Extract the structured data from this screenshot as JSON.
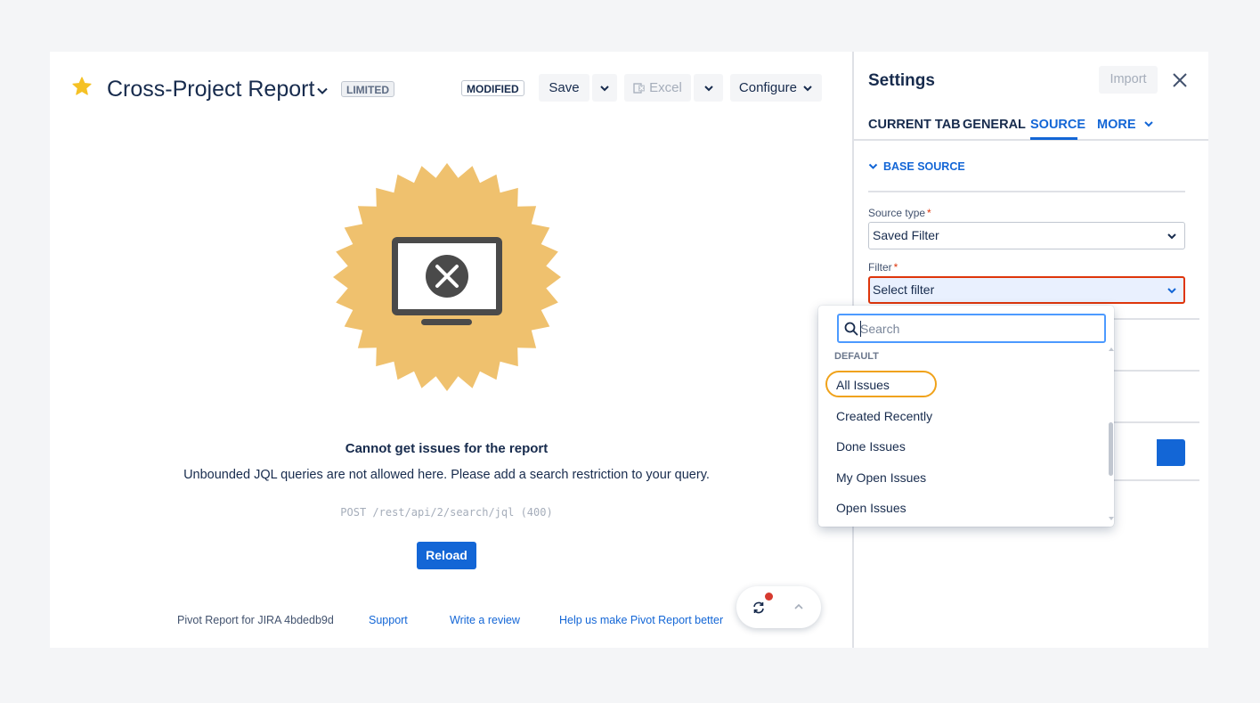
{
  "report": {
    "title": "Cross-Project Report",
    "badge_limited": "LIMITED",
    "badge_modified": "MODIFIED"
  },
  "toolbar": {
    "save_label": "Save",
    "excel_label": "Excel",
    "configure_label": "Configure"
  },
  "error": {
    "title": "Cannot get issues for the report",
    "message": "Unbounded JQL queries are not allowed here. Please add a search restriction to your query.",
    "code": "POST /rest/api/2/search/jql (400)",
    "reload_label": "Reload"
  },
  "footer": {
    "version": "Pivot Report for JIRA 4bdedb9d",
    "support": "Support",
    "review": "Write a review",
    "feedback": "Help us make Pivot Report better"
  },
  "settings": {
    "title": "Settings",
    "import_label": "Import",
    "tabs": [
      {
        "label": "CURRENT TAB"
      },
      {
        "label": "GENERAL"
      },
      {
        "label": "SOURCE"
      },
      {
        "label": "MORE"
      }
    ],
    "active_tab": "SOURCE",
    "section_label": "BASE SOURCE",
    "source_type": {
      "label": "Source type",
      "required": "*",
      "value": "Saved Filter"
    },
    "filter": {
      "label": "Filter",
      "required": "*",
      "value": "Select filter"
    }
  },
  "filter_menu": {
    "search_placeholder": "Search",
    "group_label": "DEFAULT",
    "items": [
      {
        "label": "All Issues"
      },
      {
        "label": "Created Recently"
      },
      {
        "label": "Done Issues"
      },
      {
        "label": "My Open Issues"
      },
      {
        "label": "Open Issues"
      }
    ]
  },
  "colors": {
    "accent": "#1366d6",
    "error_border": "#de350b",
    "highlight_ring": "#f0a21a",
    "seal": "#efc16e",
    "notification_dot": "#d63a2f"
  },
  "icons": [
    "star-icon",
    "chevron-down-icon",
    "excel-icon",
    "monitor-error-icon",
    "close-icon",
    "search-icon",
    "sync-icon",
    "chevron-up-icon"
  ]
}
